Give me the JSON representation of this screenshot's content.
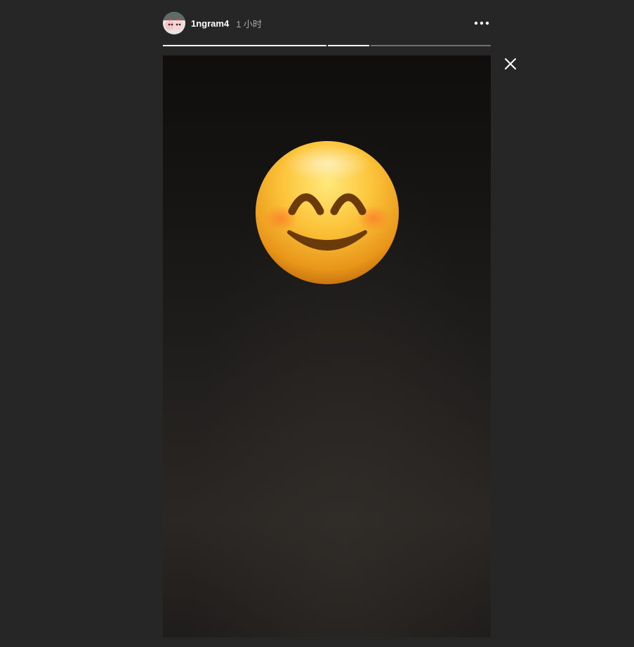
{
  "story": {
    "username": "1ngram4",
    "time_ago": "1 小时",
    "progress": [
      {
        "filled": 1.0
      },
      {
        "filled": 1.0
      },
      {
        "filled": 0.0
      }
    ],
    "sticker": "smiling-face-with-smiling-eyes"
  },
  "icons": {
    "more": "more-horizontal-icon",
    "close": "close-icon"
  },
  "colors": {
    "background": "#262626",
    "text_primary": "#ffffff",
    "text_secondary": "#a8a8a8"
  }
}
